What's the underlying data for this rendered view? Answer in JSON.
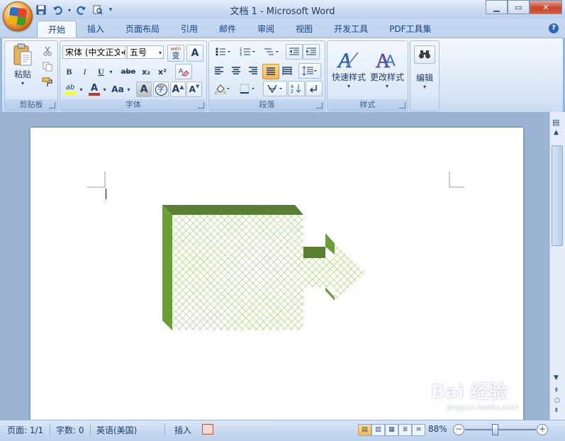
{
  "window": {
    "title": "文档 1 - Microsoft Word",
    "controls": [
      "minimize",
      "maximize",
      "close"
    ]
  },
  "quick_access": [
    {
      "name": "save-icon",
      "glyph": "💾"
    },
    {
      "name": "undo-icon",
      "glyph": "↶"
    },
    {
      "name": "redo-icon",
      "glyph": "↻"
    },
    {
      "name": "print-preview-icon",
      "glyph": "🔍"
    },
    {
      "name": "customize-icon",
      "glyph": "▾"
    }
  ],
  "tabs": [
    {
      "label": "开始",
      "active": true
    },
    {
      "label": "插入"
    },
    {
      "label": "页面布局"
    },
    {
      "label": "引用"
    },
    {
      "label": "邮件"
    },
    {
      "label": "审阅"
    },
    {
      "label": "视图"
    },
    {
      "label": "开发工具"
    },
    {
      "label": "PDF工具集"
    }
  ],
  "ribbon": {
    "clipboard": {
      "label": "剪贴板",
      "paste_label": "粘贴"
    },
    "font": {
      "label": "字体",
      "font_name": "宋体 (中文正文)",
      "font_size": "五号",
      "wen_label": "wén",
      "wen_char": "变",
      "boxed_a": "A",
      "bold": "B",
      "italic": "I",
      "underline": "U",
      "strike": "abe",
      "subscript": "x₂",
      "superscript": "x²",
      "highlight": "ab",
      "font_color": "A",
      "change_case": "Aa",
      "shade_a": "A",
      "encircle": "字",
      "grow": "A",
      "shrink": "A"
    },
    "paragraph": {
      "label": "段落"
    },
    "styles": {
      "label": "样式",
      "quick_styles": "快速样式",
      "change_styles": "更改样式"
    },
    "editing": {
      "label": "编辑"
    }
  },
  "document": {
    "shape": "3d-arrow",
    "fill_color": "#8fbf4a",
    "face_color": "#6aa033",
    "top_color": "#5a7f32"
  },
  "statusbar": {
    "page": "页面: 1/1",
    "words": "字数: 0",
    "language": "英语(美国)",
    "mode": "插入",
    "zoom": "88%"
  },
  "watermark": {
    "text": "Bai 经验",
    "sub": "jingyan.baidu.com"
  }
}
